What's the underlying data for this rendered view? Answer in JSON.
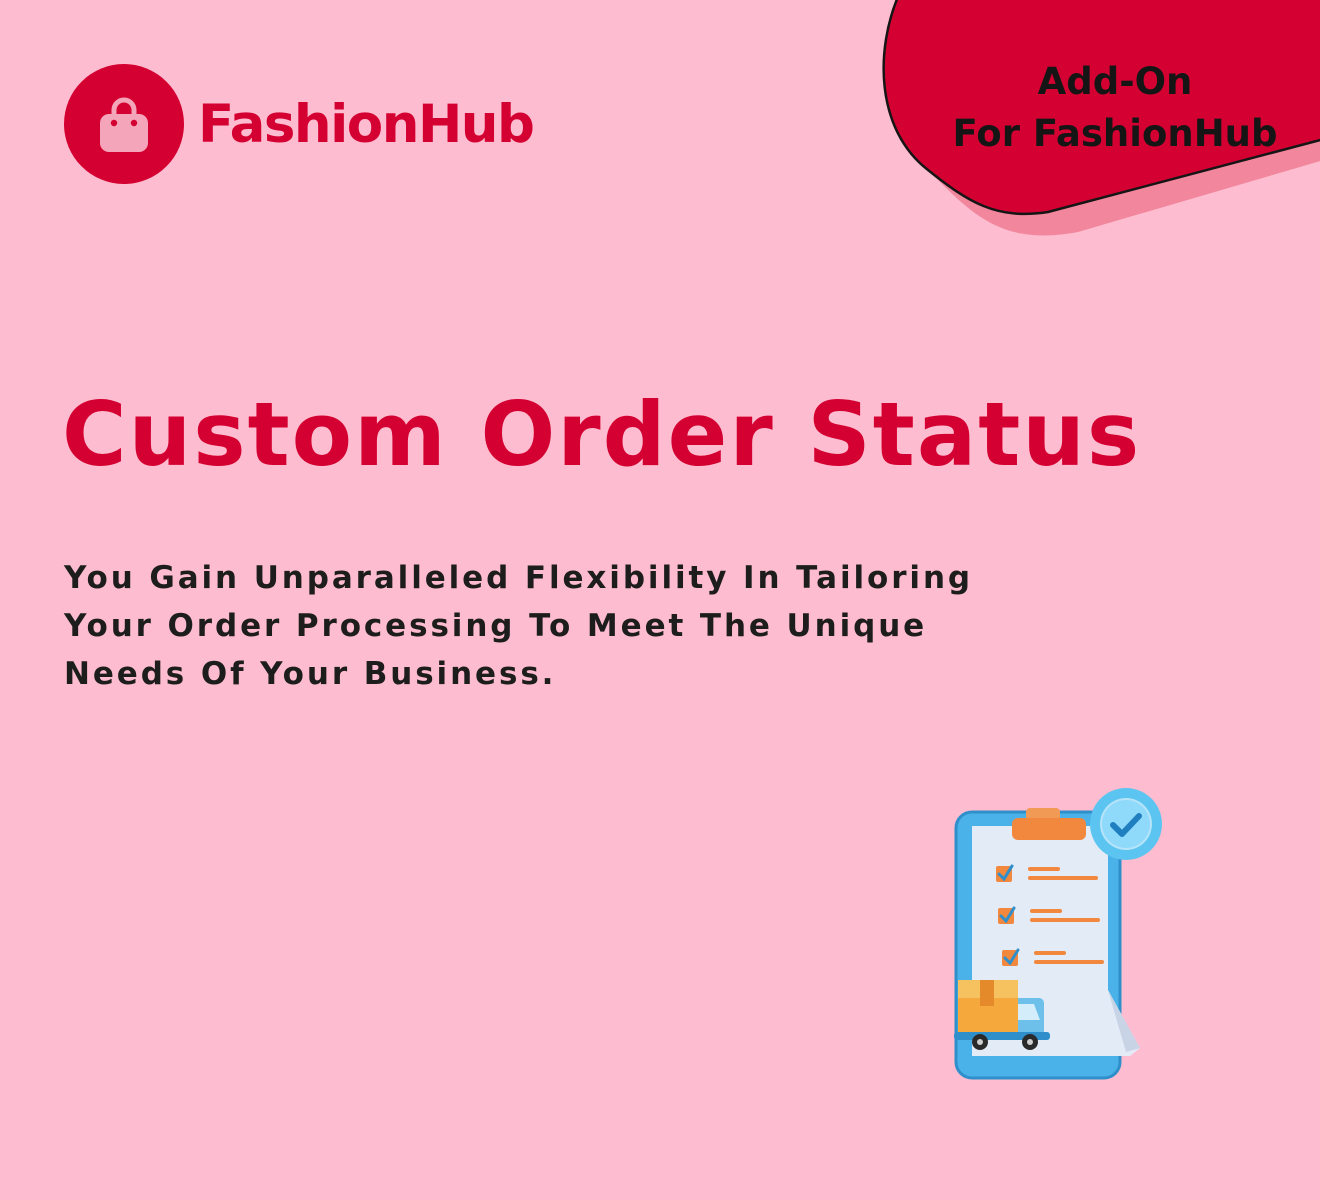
{
  "brand": {
    "name": "FashionHub",
    "logo_icon": "shopping-bag-icon",
    "accent_color": "#d50032",
    "background_color": "#fdbccf"
  },
  "badge": {
    "line1": "Add-On",
    "line2": "For FashionHub"
  },
  "hero": {
    "title": "Custom Order Status",
    "subtitle_lines": [
      "You Gain Unparalleled Flexibility In Tailoring",
      "Your Order Processing To Meet The Unique",
      "Needs Of Your Business."
    ]
  },
  "illustration": {
    "icon": "clipboard-checklist-delivery-icon"
  }
}
